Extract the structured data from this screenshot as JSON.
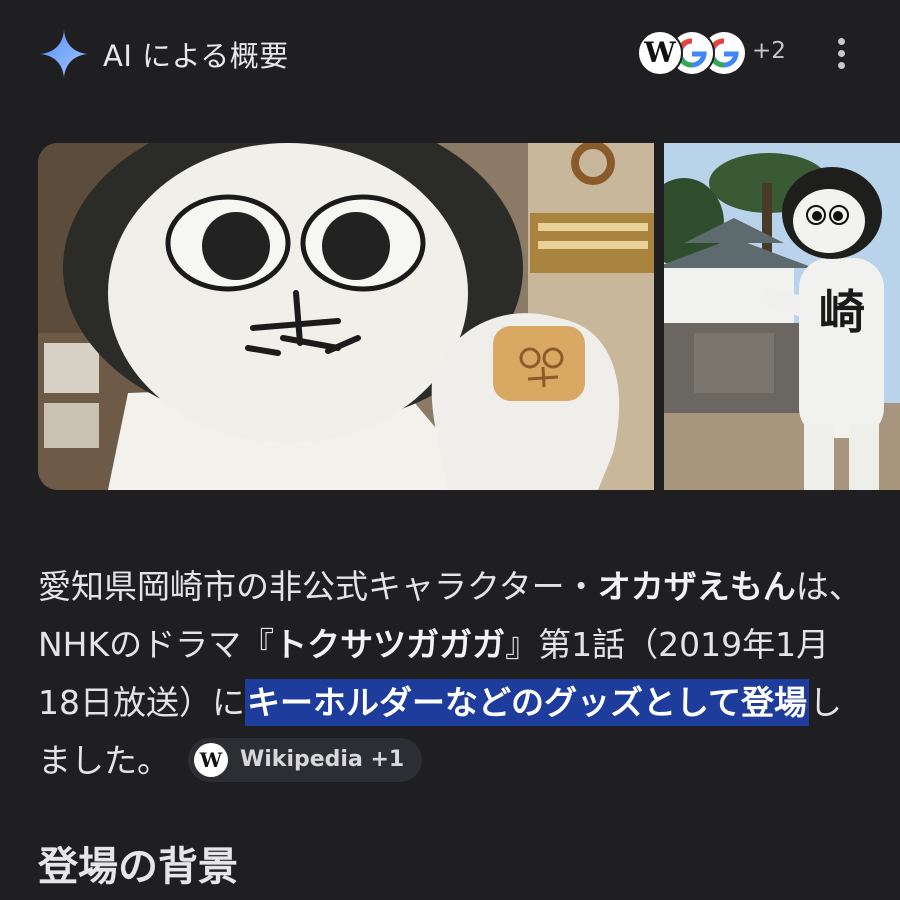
{
  "header": {
    "title": "AI による概要",
    "sources": {
      "icons": [
        "wikipedia-icon",
        "google-icon",
        "google-icon"
      ],
      "extra_count": "+2"
    },
    "menu_icon": "more-vert-icon"
  },
  "images": [
    {
      "name": "okazaemon-keyholder-photo"
    },
    {
      "name": "okazaemon-castle-photo"
    }
  ],
  "summary": {
    "part1": "愛知県岡崎市の非公式キャラクター・",
    "bold1": "オカザえもん",
    "part2": "は、NHKのドラマ『",
    "bold2": "トクサツガガガ",
    "part3": "』第1話（2019年1月18日放送）に",
    "highlight": "キーホルダーなどのグッズとして登場",
    "part4": "しました。",
    "chip": {
      "icon": "W",
      "label": "Wikipedia +1"
    }
  },
  "section_heading": "登場の背景",
  "colors": {
    "background": "#1f1f22",
    "highlight": "#1e3c9c",
    "chip": "#2d2e33"
  }
}
